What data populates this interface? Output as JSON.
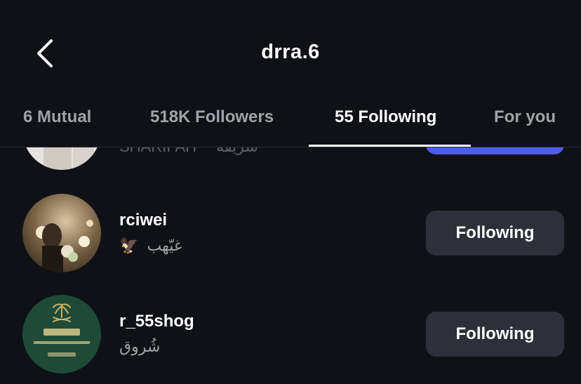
{
  "header": {
    "title": "drra.6",
    "back_icon": "chevron-left-icon"
  },
  "tabs": [
    {
      "label": "6 Mutual",
      "active": false
    },
    {
      "label": "518K Followers",
      "active": false
    },
    {
      "label": "55 Following",
      "active": true
    },
    {
      "label": "For you",
      "active": false
    }
  ],
  "users": [
    {
      "username": "",
      "subtitle": "SHARIFAH",
      "subtitle_ar": "شريفة",
      "button": ""
    },
    {
      "username": "rciwei",
      "subtitle": "غيّهب",
      "emoji": "🦅",
      "button": "Following"
    },
    {
      "username": "r_55shog",
      "subtitle": "شُروق",
      "button": "Following"
    }
  ],
  "colors": {
    "background": "#0f1116",
    "button_bg": "#2d3038",
    "accent_blue": "#4e5cf2",
    "muted_text": "#9ea3ab"
  }
}
